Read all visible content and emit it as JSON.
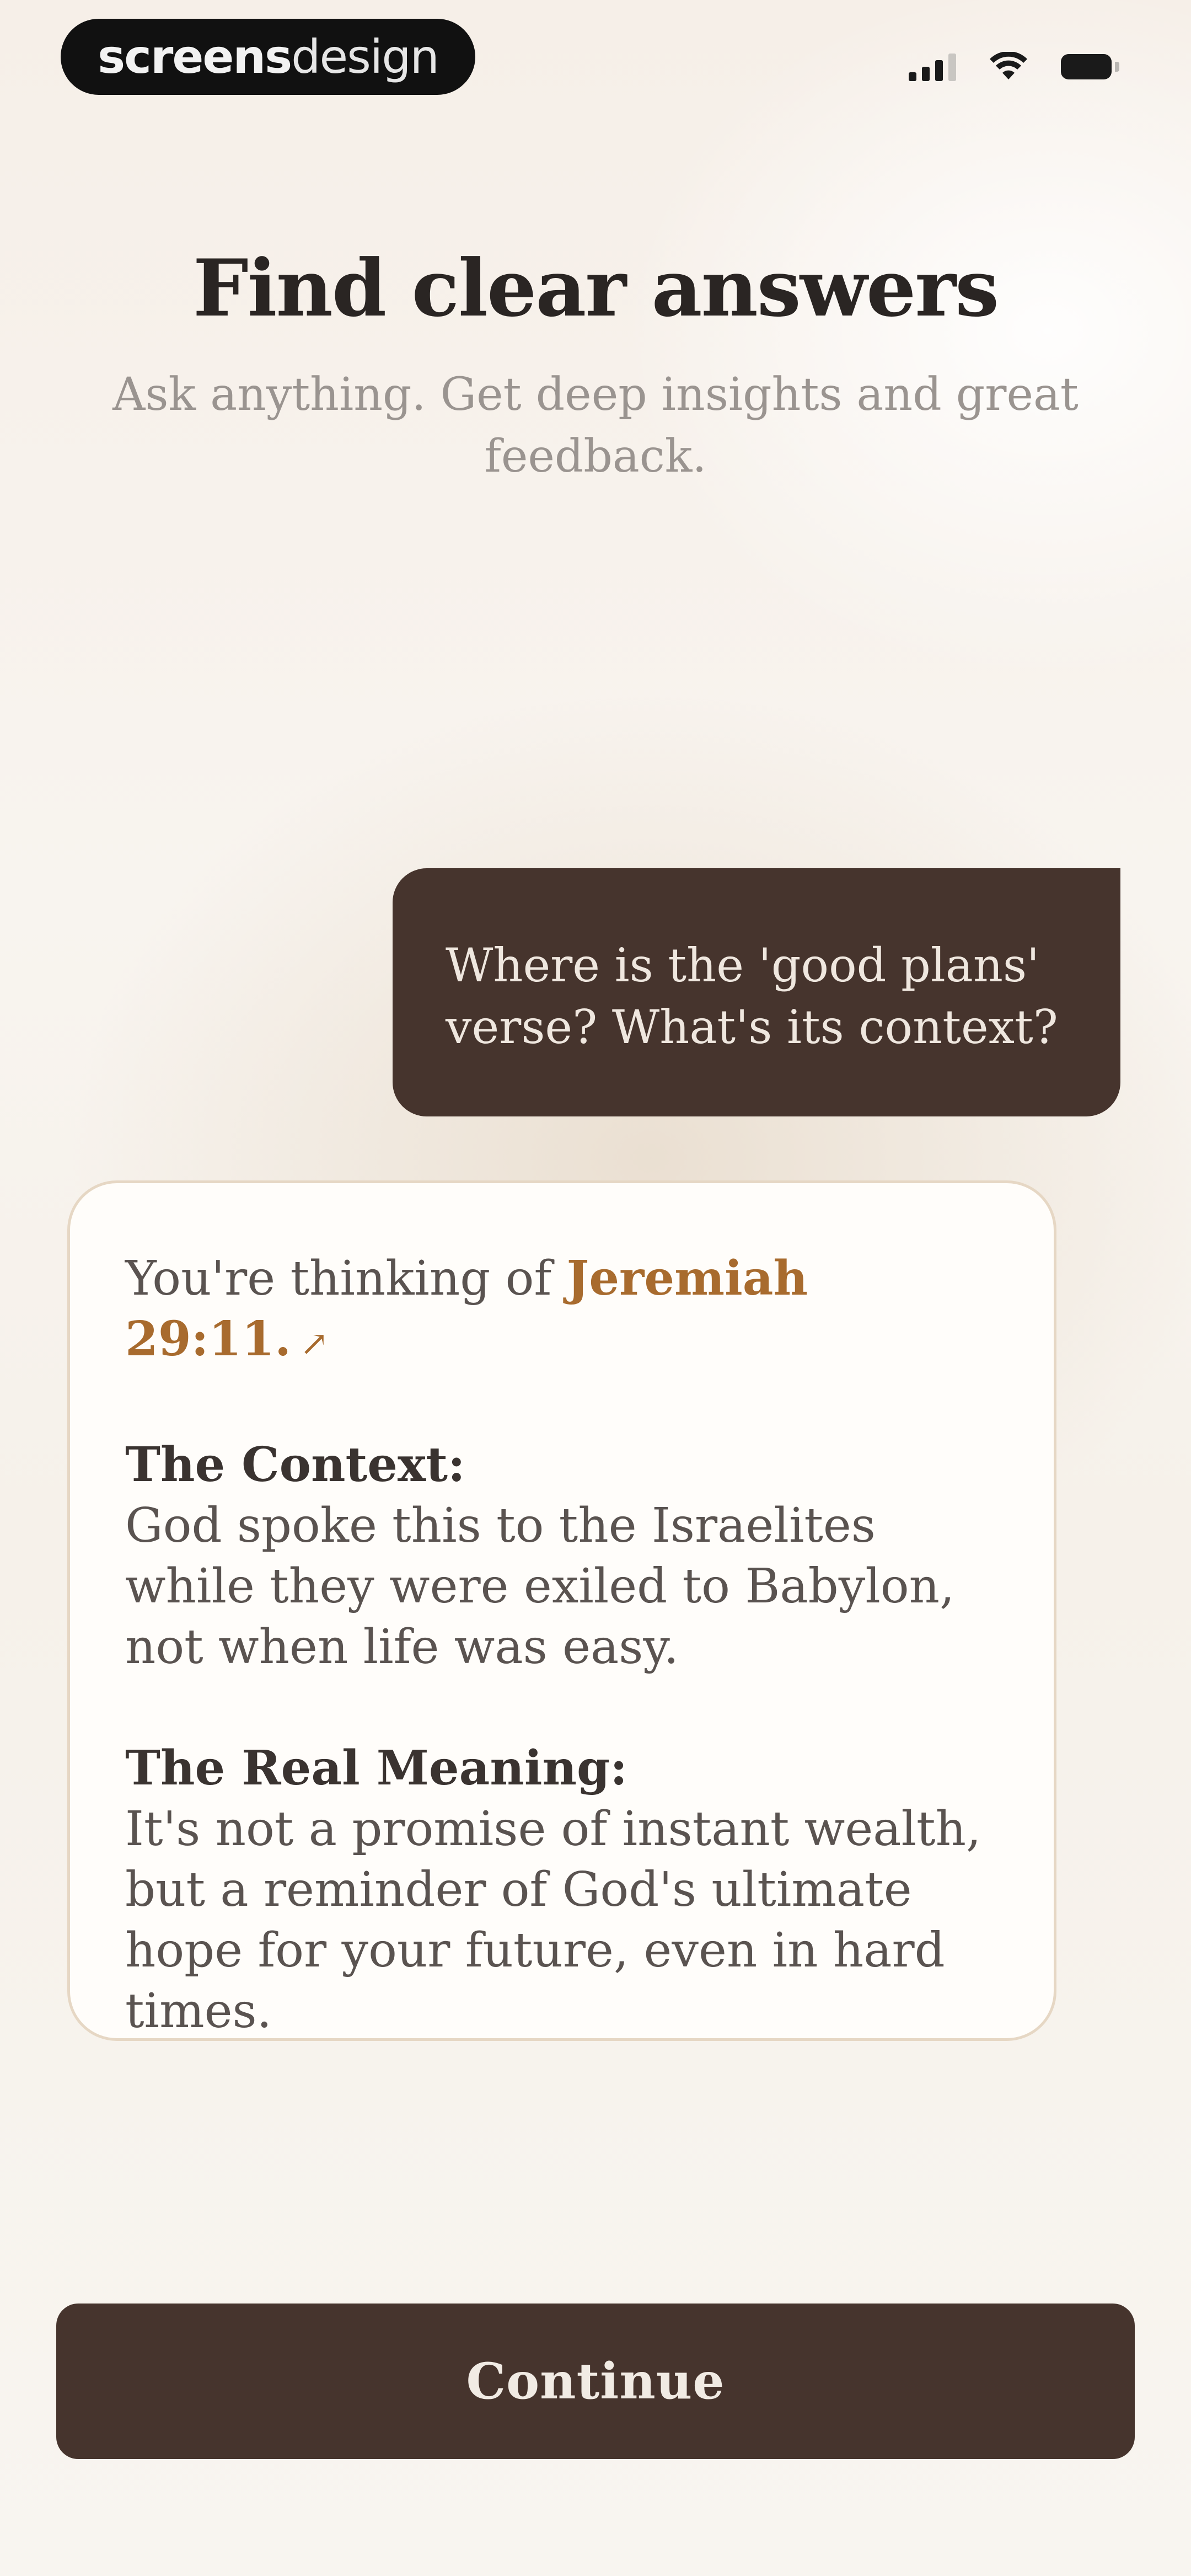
{
  "status_bar": {
    "brand_strong": "screens",
    "brand_light": "design",
    "icons": [
      "cellular-signal-icon",
      "wifi-icon",
      "battery-icon"
    ]
  },
  "header": {
    "title": "Find clear answers",
    "subtitle": "Ask anything. Get deep insights and great feedback."
  },
  "chat": {
    "user_message": "Where is the 'good plans' verse? What's its context?",
    "assistant": {
      "intro_prefix": "You're thinking of",
      "reference": "Jeremiah 29:11.",
      "reference_icon": "external-link-arrow-icon",
      "sections": [
        {
          "heading": "The Context:",
          "body": "God spoke this to the Israelites while they were exiled to Babylon, not when life was easy."
        },
        {
          "heading": "The Real Meaning:",
          "body": "It's not a promise of instant wealth, but a reminder of God's ultimate hope for your future, even in hard times."
        }
      ]
    }
  },
  "footer": {
    "continue_label": "Continue"
  },
  "colors": {
    "accent_dark": "#46342d",
    "reference_gold": "#a86b2e",
    "card_border": "#e6d7c4"
  }
}
